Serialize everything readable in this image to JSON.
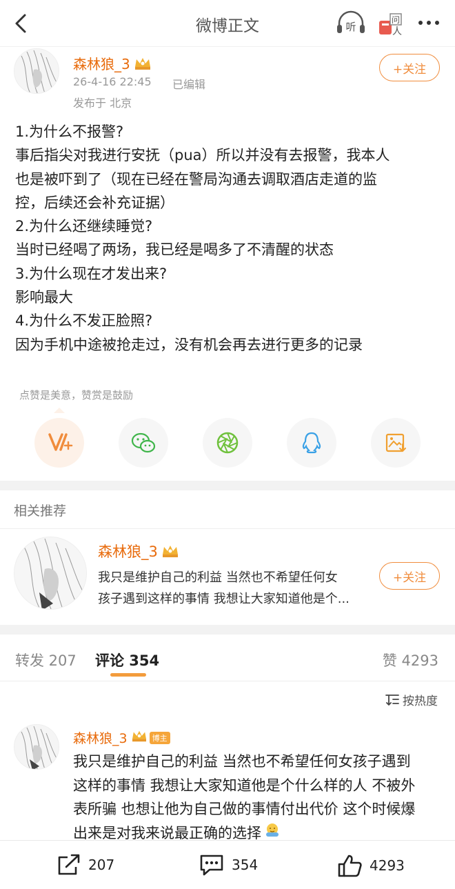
{
  "header": {
    "title": "微博正文"
  },
  "author": {
    "name": "森林狼_3",
    "time": "26-4-16 22:45",
    "edited": "已编辑",
    "location": "发布于 北京",
    "follow_label": "+关注"
  },
  "post": {
    "lines": [
      "1.为什么不报警?",
      "事后指尖对我进行安抚（pua）所以并没有去报警，我本人",
      "也是被吓到了（现在已经在警局沟通去调取酒店走道的监",
      "控，后续还会补充证据）",
      "2.为什么还继续睡觉?",
      "当时已经喝了两场，我已经是喝多了不清醒的状态",
      "3.为什么现在才发出来?",
      "影响最大",
      "4.为什么不发正脸照?",
      "因为手机中途被抢走过，没有机会再去进行更多的记录"
    ]
  },
  "reward": {
    "tip": "点赞是美意，赞赏是鼓励"
  },
  "share_icons": [
    "reward-v-icon",
    "wechat-icon",
    "moments-icon",
    "qq-icon",
    "save-image-icon"
  ],
  "related": {
    "title": "相关推荐",
    "name": "森林狼_3",
    "text_line1": "我只是维护自己的利益 当然也不希望任何女",
    "text_line2": "孩子遇到这样的事情 我想让大家知道他是个...",
    "follow_label": "+关注"
  },
  "tabs": {
    "repost": "转发 207",
    "comment": "评论 354",
    "like": "赞 4293"
  },
  "sort": {
    "label": "按热度"
  },
  "comment": {
    "name": "森林狼_3",
    "badge": "博主",
    "lines": [
      "我只是维护自己的利益 当然也不希望任何女孩子遇到",
      "这样的事情 我想让大家知道他是个什么样的人 不被外",
      "表所骗 也想让他为自己做的事情付出代价 这个时候爆",
      "出来是对我来说最正确的选择"
    ]
  },
  "bottom": {
    "repost": "207",
    "comment": "354",
    "like": "4293"
  },
  "colors": {
    "accent": "#e86b0c",
    "follow": "#f08c3c",
    "tab_underline": "#f39c3c"
  }
}
